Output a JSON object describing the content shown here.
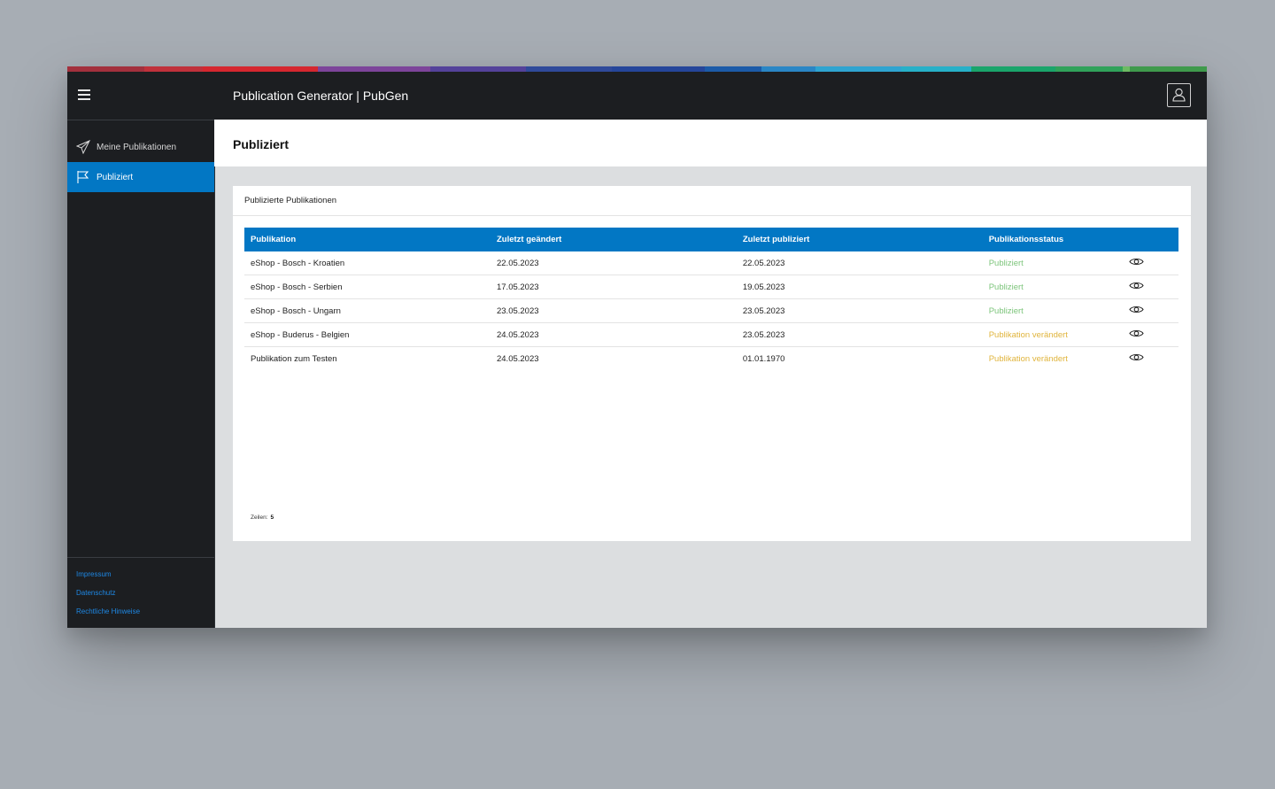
{
  "colors": {
    "accent": "#0277c4",
    "sidebar_bg": "#1c1e21",
    "status_published": "#7cc47a",
    "status_changed": "#e0b43c",
    "link": "#1e88e5"
  },
  "color_bar": [
    "#a3303d",
    "#c0313b",
    "#d5272f",
    "#7d449a",
    "#54429a",
    "#2f4a9a",
    "#25469a",
    "#1c5ba8",
    "#2a86c5",
    "#2fa4d0",
    "#27b0c8",
    "#1aa56b",
    "#30a25a",
    "#6cbb63",
    "#3f9a4c"
  ],
  "app": {
    "title": "Publication Generator | PubGen"
  },
  "topbar": {
    "menu_icon": "hamburger-icon",
    "user_icon": "user-icon"
  },
  "sidebar": {
    "items": [
      {
        "label": "Meine Publikationen",
        "icon": "paper-plane-icon",
        "active": false
      },
      {
        "label": "Publiziert",
        "icon": "flag-icon",
        "active": true
      }
    ],
    "footer_links": [
      "Impressum",
      "Datenschutz",
      "Rechtliche Hinweise"
    ]
  },
  "page": {
    "title": "Publiziert"
  },
  "card": {
    "title": "Publizierte Publikationen",
    "table": {
      "headers": [
        "Publikation",
        "Zuletzt geändert",
        "Zuletzt publiziert",
        "Publikationsstatus"
      ],
      "rows": [
        {
          "name": "eShop - Bosch - Kroatien",
          "changed": "22.05.2023",
          "published": "22.05.2023",
          "status": "Publiziert",
          "status_type": "ok"
        },
        {
          "name": "eShop - Bosch - Serbien",
          "changed": "17.05.2023",
          "published": "19.05.2023",
          "status": "Publiziert",
          "status_type": "ok"
        },
        {
          "name": "eShop - Bosch - Ungarn",
          "changed": "23.05.2023",
          "published": "23.05.2023",
          "status": "Publiziert",
          "status_type": "ok"
        },
        {
          "name": "eShop - Buderus - Belgien",
          "changed": "24.05.2023",
          "published": "23.05.2023",
          "status": "Publikation verändert",
          "status_type": "changed"
        },
        {
          "name": "Publikation zum Testen",
          "changed": "24.05.2023",
          "published": "01.01.1970",
          "status": "Publikation verändert",
          "status_type": "changed"
        }
      ],
      "row_action_icon": "eye-icon"
    },
    "rows_label": "Zeilen:",
    "rows_count": "5"
  }
}
